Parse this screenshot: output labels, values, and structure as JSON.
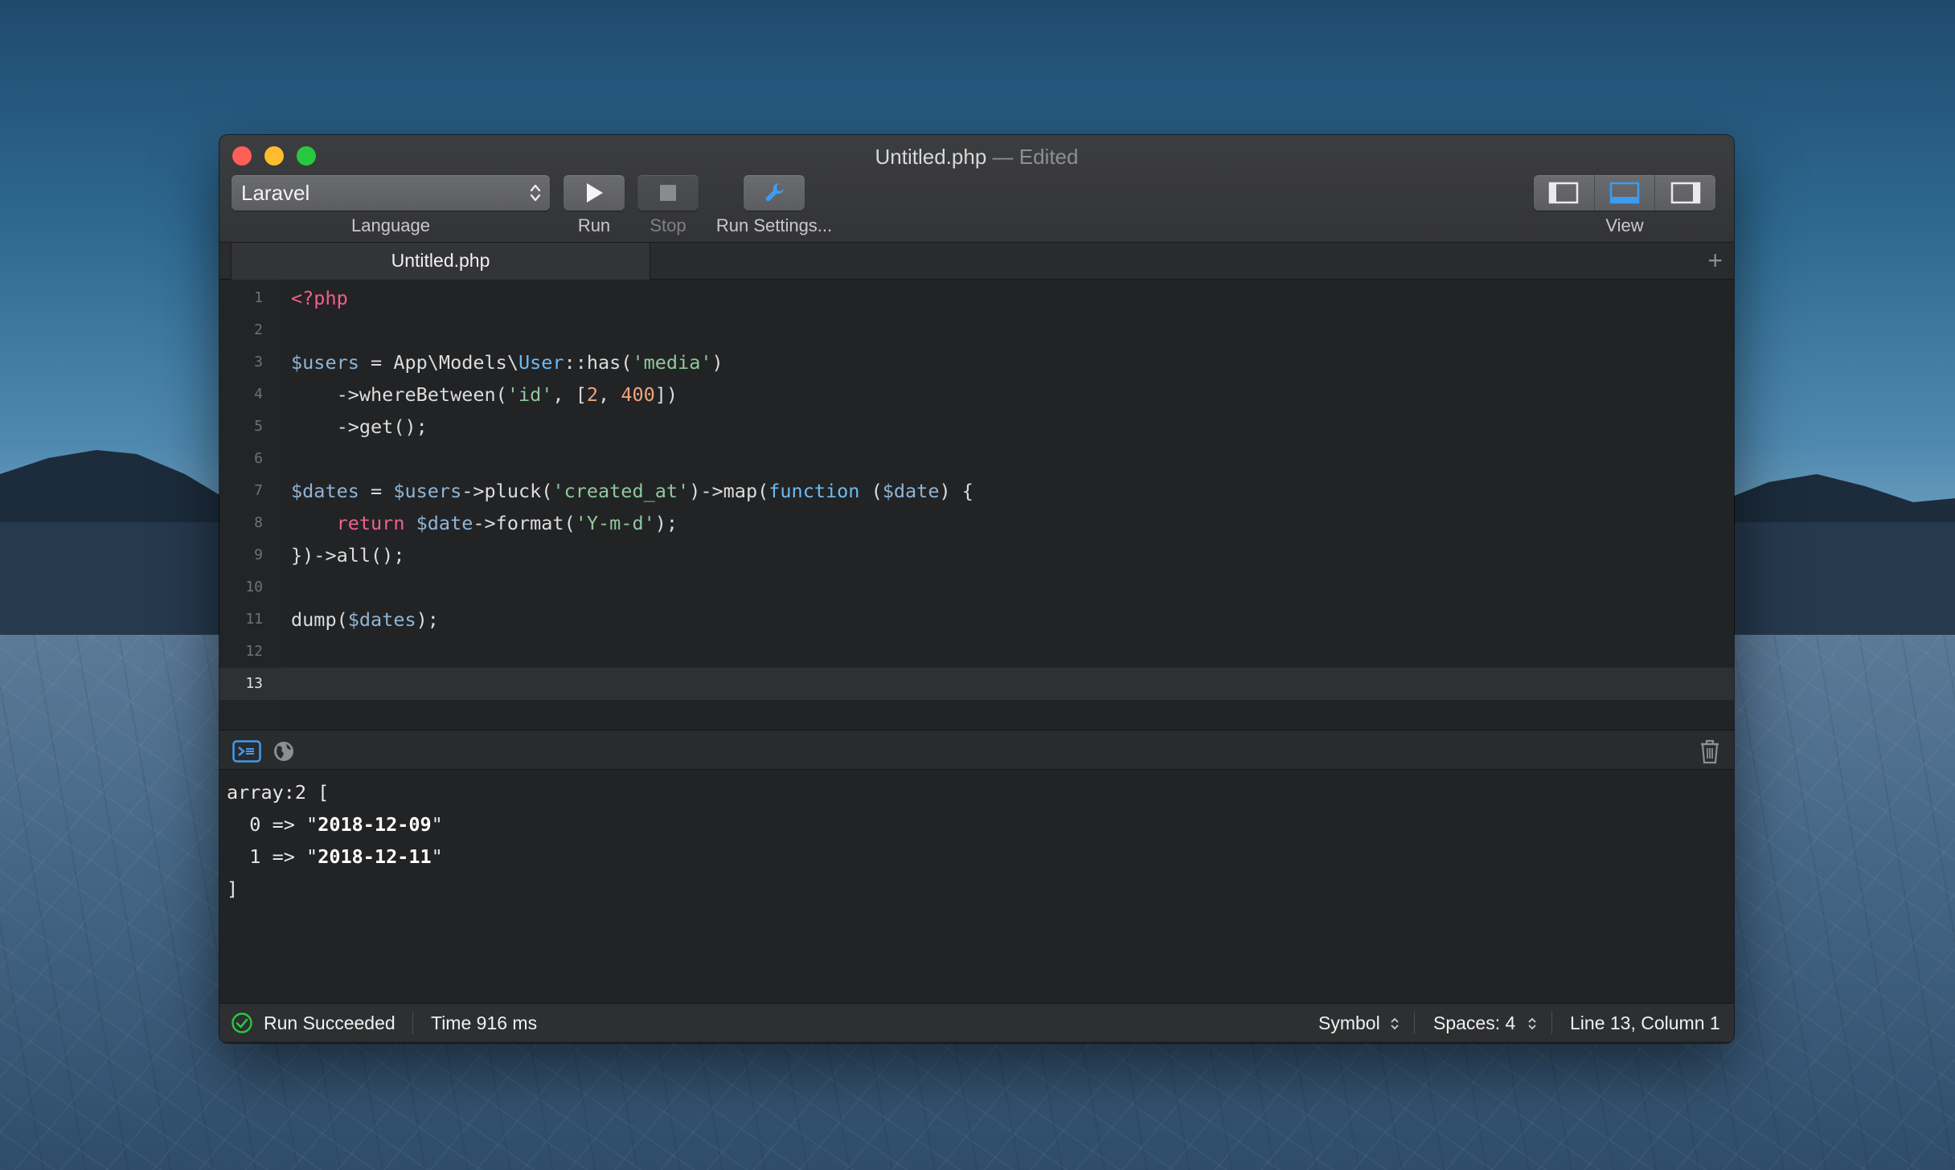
{
  "window": {
    "title": "Untitled.php",
    "title_suffix": "— Edited"
  },
  "toolbar": {
    "language_value": "Laravel",
    "language_label": "Language",
    "run_label": "Run",
    "stop_label": "Stop",
    "settings_label": "Run Settings...",
    "view_label": "View"
  },
  "tabs": [
    {
      "label": "Untitled.php",
      "active": true
    }
  ],
  "editor": {
    "active_line": 13,
    "lines": [
      {
        "num": "1",
        "html": "<span class=\"k\">&lt;?php</span>"
      },
      {
        "num": "2",
        "html": ""
      },
      {
        "num": "3",
        "html": "<span class=\"v\">$users</span> = App\\Models\\<span class=\"c\">User</span>::has(<span class=\"s\">'media'</span>)"
      },
      {
        "num": "4",
        "html": "    -&gt;whereBetween(<span class=\"s\">'id'</span>, [<span class=\"n\">2</span>, <span class=\"n\">400</span>])"
      },
      {
        "num": "5",
        "html": "    -&gt;get();"
      },
      {
        "num": "6",
        "html": ""
      },
      {
        "num": "7",
        "html": "<span class=\"v\">$dates</span> = <span class=\"v\">$users</span>-&gt;pluck(<span class=\"s\">'created_at'</span>)-&gt;map(<span class=\"f\">function</span> (<span class=\"v\">$date</span>) {"
      },
      {
        "num": "8",
        "html": "    <span class=\"k\">return</span> <span class=\"v\">$date</span>-&gt;format(<span class=\"s\">'Y-m-d'</span>);"
      },
      {
        "num": "9",
        "html": "})-&gt;all();"
      },
      {
        "num": "10",
        "html": ""
      },
      {
        "num": "11",
        "html": "dump(<span class=\"v\">$dates</span>);"
      },
      {
        "num": "12",
        "html": ""
      },
      {
        "num": "13",
        "html": ""
      }
    ]
  },
  "output": {
    "lines": [
      {
        "pre": "array:2 [",
        "bold": "",
        "post": ""
      },
      {
        "pre": "  0 => \"",
        "bold": "2018-12-09",
        "post": "\""
      },
      {
        "pre": "  1 => \"",
        "bold": "2018-12-11",
        "post": "\""
      },
      {
        "pre": "]",
        "bold": "",
        "post": ""
      }
    ]
  },
  "status": {
    "result": "Run Succeeded",
    "time": "Time 916 ms",
    "symbol": "Symbol",
    "spaces": "Spaces: 4",
    "position": "Line 13, Column 1"
  },
  "colors": {
    "accent": "#3d9cf0",
    "success": "#28c840"
  }
}
